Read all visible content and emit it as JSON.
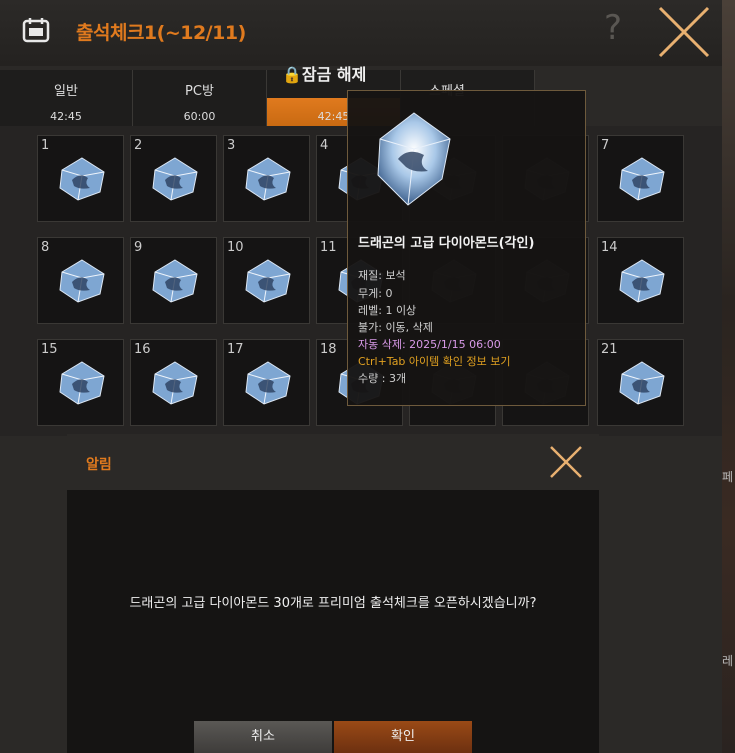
{
  "window": {
    "title": "출석체크1(~12/11)",
    "help_label": "?",
    "lock_label": "🔒잠금 해제"
  },
  "tabs": [
    {
      "label": "일반",
      "time": "42:45"
    },
    {
      "label": "PC방",
      "time": "60:00"
    },
    {
      "label": "",
      "time": "42:45"
    },
    {
      "label": "스페셜",
      "time": ""
    }
  ],
  "slots": [
    {
      "num": "1"
    },
    {
      "num": "2"
    },
    {
      "num": "3"
    },
    {
      "num": "4"
    },
    {
      "num": ""
    },
    {
      "num": ""
    },
    {
      "num": "7"
    },
    {
      "num": "8"
    },
    {
      "num": "9"
    },
    {
      "num": "10"
    },
    {
      "num": "11"
    },
    {
      "num": ""
    },
    {
      "num": ""
    },
    {
      "num": "14"
    },
    {
      "num": "15"
    },
    {
      "num": "16"
    },
    {
      "num": "17"
    },
    {
      "num": "18"
    },
    {
      "num": ""
    },
    {
      "num": ""
    },
    {
      "num": "21"
    }
  ],
  "tooltip": {
    "name": "드래곤의 고급 다이아몬드(각인)",
    "material": "재질: 보석",
    "weight": "무게: 0",
    "level": "레벨: 1 이상",
    "restriction": "불가: 이동, 삭제",
    "auto_delete": "자동 삭제: 2025/1/15 06:00",
    "shortcut": "Ctrl+Tab 아이템 확인 정보 보기",
    "quantity": "수량 : 3개"
  },
  "dialog": {
    "title": "알림",
    "message": "드래곤의 고급 다이아몬드 30개로 프리미엄 출석체크를 오픈하시겠습니까?",
    "cancel_label": "취소",
    "ok_label": "확인"
  },
  "side": {
    "chars": [
      "페",
      "레"
    ]
  },
  "colors": {
    "accent": "#e07a1e",
    "auto_delete": "#d89ae8",
    "shortcut": "#e0a020"
  }
}
